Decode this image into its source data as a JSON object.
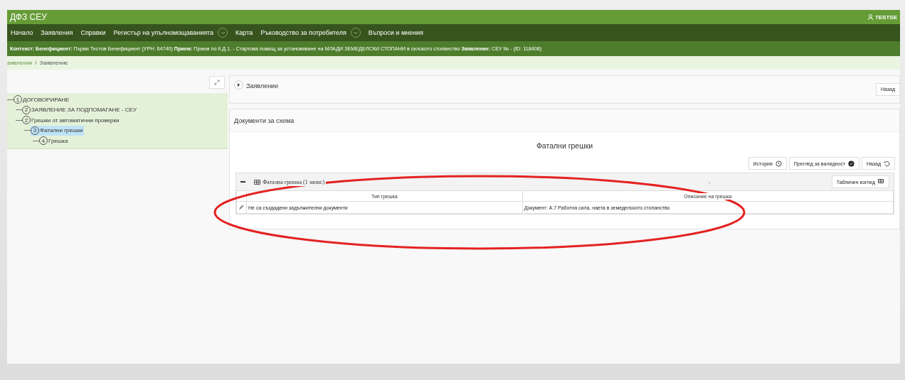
{
  "app_title": "ДФЗ СЕУ",
  "user": "TESTSE",
  "nav": [
    {
      "label": "Начало",
      "dropdown": false
    },
    {
      "label": "Заявления",
      "dropdown": false
    },
    {
      "label": "Справки",
      "dropdown": false
    },
    {
      "label": "Регистър на упълномощаванията",
      "dropdown": true
    },
    {
      "label": "Карта",
      "dropdown": false
    },
    {
      "label": "Ръководство за потребителя",
      "dropdown": true
    },
    {
      "label": "Въпроси и мнения",
      "dropdown": false
    }
  ],
  "context": "**Контекст:** **Бенефициент:** Първи Тестов Бенефициент (УРН: 64740) **Прием:** Прием по II.Д.1. - Стартова помощ за установяване на МЛАДИ ЗЕМЕДЕЛСКИ СТОПАНИ в селското стопанство **Заявление:** СЕУ № - (ID: 118408)",
  "breadcrumb": [
    "аявления",
    "/",
    "Заявление"
  ],
  "tree": [
    {
      "number": "1",
      "label": "ДОГОВОРИРАНЕ",
      "selected": false,
      "children": [
        {
          "number": "2",
          "label": "ЗАЯВЛЕНИЕ ЗА ПОДПОМАГАНЕ - СЕУ",
          "selected": false
        },
        {
          "number": "2",
          "label": "Грешки от автоматични проверки",
          "selected": false,
          "children": [
            {
              "number": "3",
              "label": "Фатални грешки",
              "selected": true,
              "children": [
                {
                  "number": "4",
                  "label": "Грешка",
                  "selected": false
                }
              ]
            }
          ]
        }
      ]
    }
  ],
  "application_card": {
    "title": "Заявление",
    "back": "Назад"
  },
  "documents_card": {
    "title": "Документи за схема",
    "heading": "Фатални грешки",
    "buttons": [
      {
        "kind": "history",
        "label": "История"
      },
      {
        "kind": "validity",
        "label": "Преглед за валидност"
      },
      {
        "kind": "back",
        "label": "Назад"
      }
    ],
    "panel": {
      "title": "Фатална грешка (1 запис)",
      "dash": "-",
      "view_button": "Табличен изглед",
      "columns": [
        "Тип грешка",
        "Описание на грешка"
      ],
      "rows": [
        [
          "Не са създадени задължителни документи",
          "Документ: А.7 Работна сила, наета в земеделското стопанство"
        ]
      ]
    }
  }
}
